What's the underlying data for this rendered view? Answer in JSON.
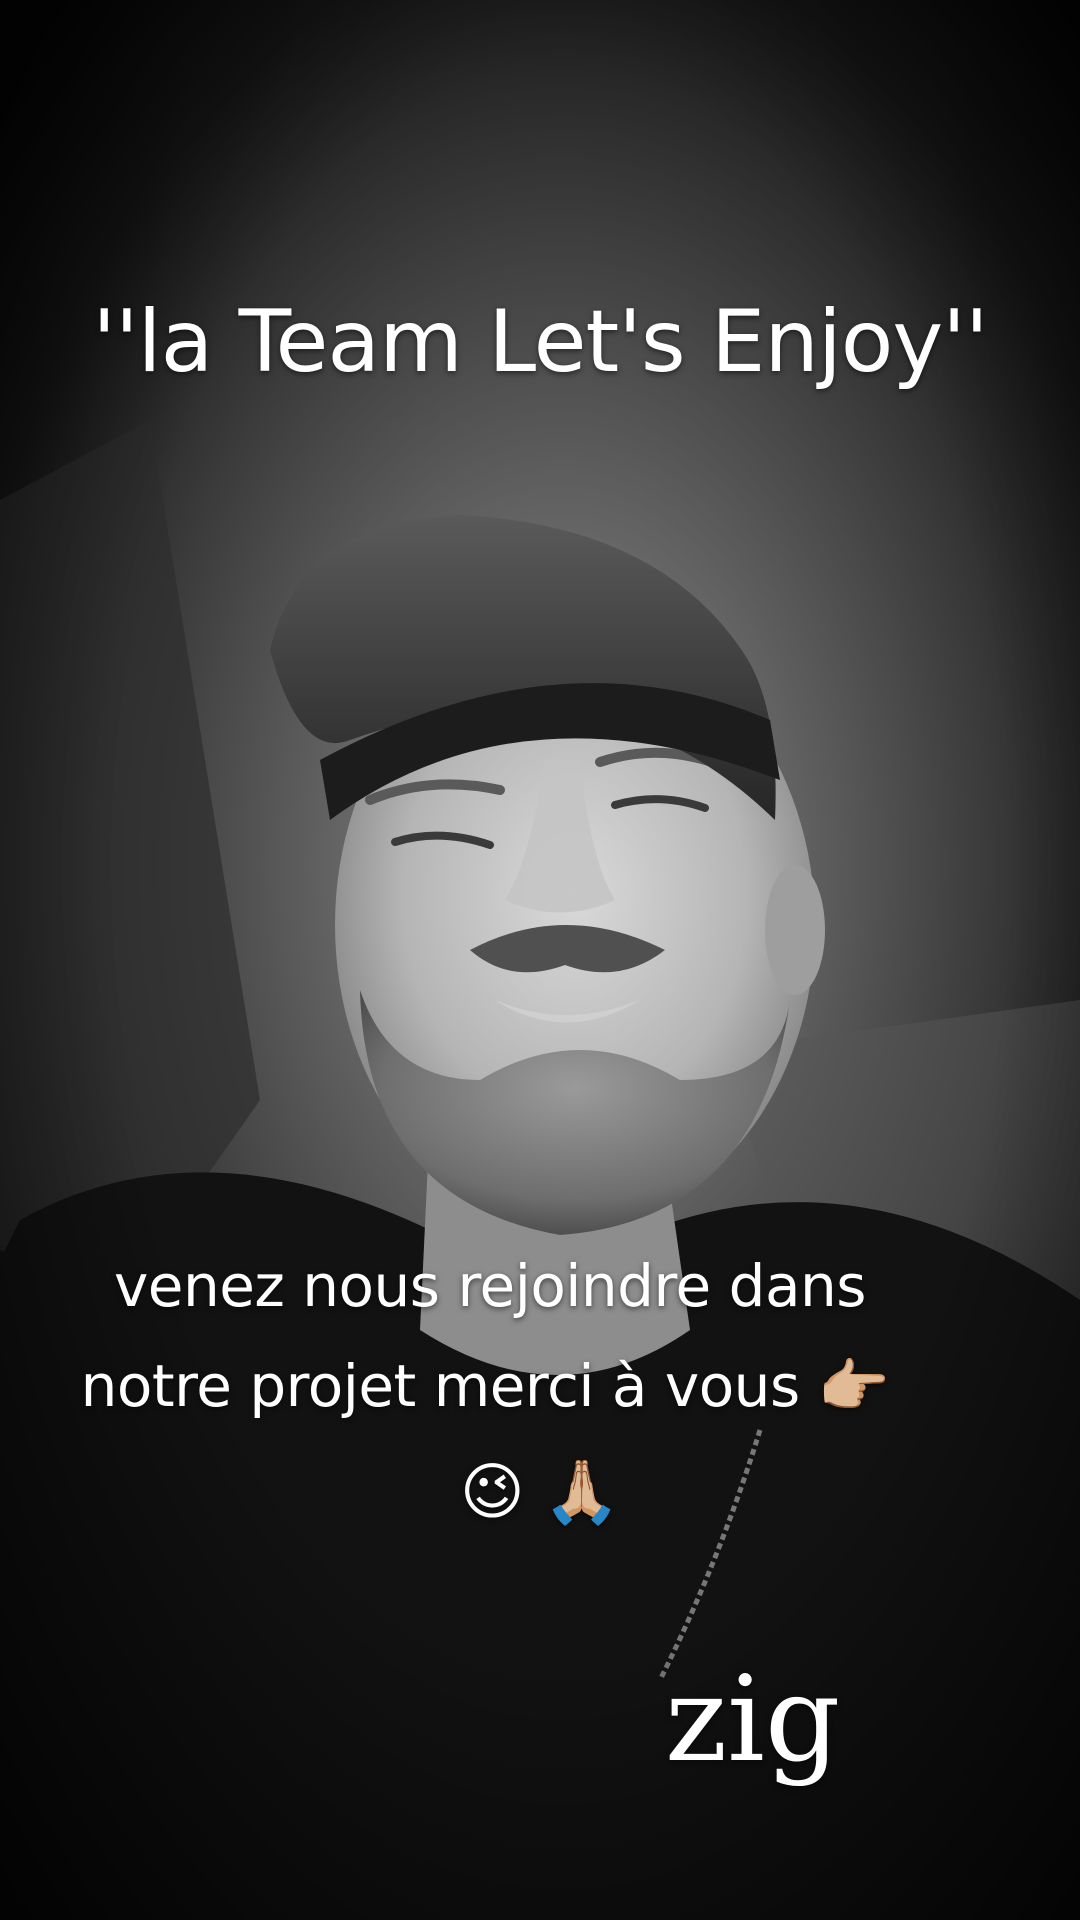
{
  "overlay": {
    "title": "''la Team Let's Enjoy''",
    "subtitle_line1": "venez nous rejoindre dans",
    "subtitle_line2": "notre projet merci à vous",
    "emoji_pointing": "👉🏼",
    "emoji_wink": "😉",
    "emoji_pray": "🙏🏼",
    "signature": "zig"
  },
  "image": {
    "description_icon": "man-in-cap-portrait"
  }
}
